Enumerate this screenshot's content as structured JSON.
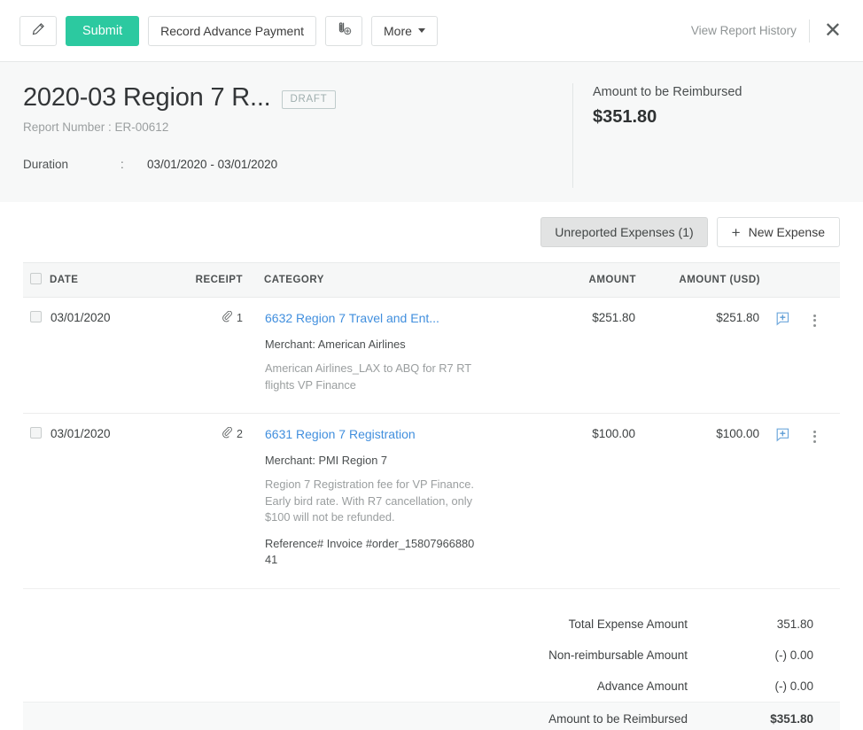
{
  "toolbar": {
    "edit_icon": "pencil-icon",
    "submit_label": "Submit",
    "record_advance_label": "Record Advance Payment",
    "attach_icon": "attachment-add-icon",
    "more_label": "More",
    "view_history_label": "View Report History",
    "close_icon": "close-icon"
  },
  "header": {
    "title": "2020-03 Region 7 R...",
    "status_badge": "DRAFT",
    "report_number": "Report Number : ER-00612",
    "duration_label": "Duration",
    "duration_colon": ":",
    "duration_value": "03/01/2020 - 03/01/2020",
    "reimburse_label": "Amount to be Reimbursed",
    "reimburse_value": "$351.80"
  },
  "actions": {
    "unreported_label": "Unreported Expenses (1)",
    "new_expense_label": "New Expense",
    "new_expense_icon": "plus-icon"
  },
  "table": {
    "columns": {
      "date": "DATE",
      "receipt": "RECEIPT",
      "category": "CATEGORY",
      "amount": "AMOUNT",
      "amount_usd": "AMOUNT (USD)"
    },
    "rows": [
      {
        "date": "03/01/2020",
        "receipt_count": "1",
        "receipt_icon": "paperclip-icon",
        "category": "6632 Region 7 Travel and Ent...",
        "merchant": "Merchant: American Airlines",
        "description": "American Airlines_LAX to ABQ for R7 RT flights VP Finance",
        "reference": "",
        "amount": "$251.80",
        "amount_usd": "$251.80",
        "comment_icon": "add-comment-icon",
        "menu_icon": "more-vertical-icon"
      },
      {
        "date": "03/01/2020",
        "receipt_count": "2",
        "receipt_icon": "paperclip-icon",
        "category": "6631 Region 7 Registration",
        "merchant": "Merchant: PMI Region 7",
        "description": "Region 7 Registration fee for VP Finance. Early bird rate. With R7 cancellation, only $100 will not be refunded.",
        "reference": "Reference# Invoice #order_1580796688041",
        "amount": "$100.00",
        "amount_usd": "$100.00",
        "comment_icon": "add-comment-icon",
        "menu_icon": "more-vertical-icon"
      }
    ]
  },
  "totals": [
    {
      "label": "Total Expense Amount",
      "value": "351.80"
    },
    {
      "label": "Non-reimbursable Amount",
      "value": "(-) 0.00"
    },
    {
      "label": "Advance Amount",
      "value": "(-) 0.00"
    }
  ],
  "total_final": {
    "label": "Amount to be Reimbursed",
    "value": "$351.80"
  },
  "colors": {
    "accent_green": "#2cc9a0",
    "link_blue": "#418fde",
    "header_band": "#f7f8f8",
    "badge_gray": "#9eadad"
  }
}
